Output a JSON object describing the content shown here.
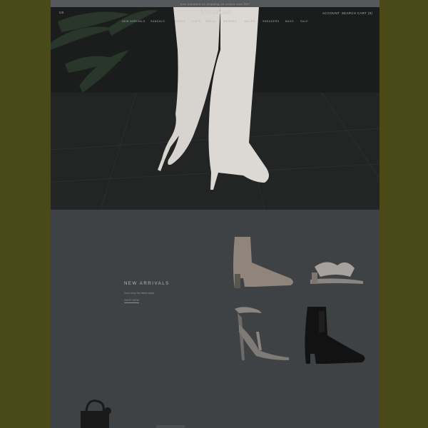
{
  "announcement": "free standard us shipping on orders over $50",
  "header": {
    "country": "US",
    "logo": "Vivarosa",
    "links": {
      "account": "ACCOUNT",
      "search": "SEARCH",
      "cart": "CART (0)"
    }
  },
  "nav": {
    "items": [
      "NEW ARRIVALS",
      "SANDALS",
      "BOOTS",
      "FLATS",
      "HEELS",
      "WEDGES",
      "MULES",
      "SNEAKERS",
      "BAGS",
      "SALE"
    ]
  },
  "collection": {
    "title": "NEW ARRIVALS",
    "subtitle": "Don't miss the latest styles",
    "shop_link": "SHOP NOW"
  },
  "products": [
    {
      "name": "taupe-pointed-ankle-bootie",
      "color": "#8f857b"
    },
    {
      "name": "snake-print-knot-mule",
      "color": "#9a9590"
    },
    {
      "name": "snake-print-ankle-strap-heel",
      "color": "#7e7a76"
    },
    {
      "name": "black-chelsea-bootie",
      "color": "#121212"
    },
    {
      "name": "black-knot-handbag",
      "color": "#1a1a1a"
    }
  ]
}
